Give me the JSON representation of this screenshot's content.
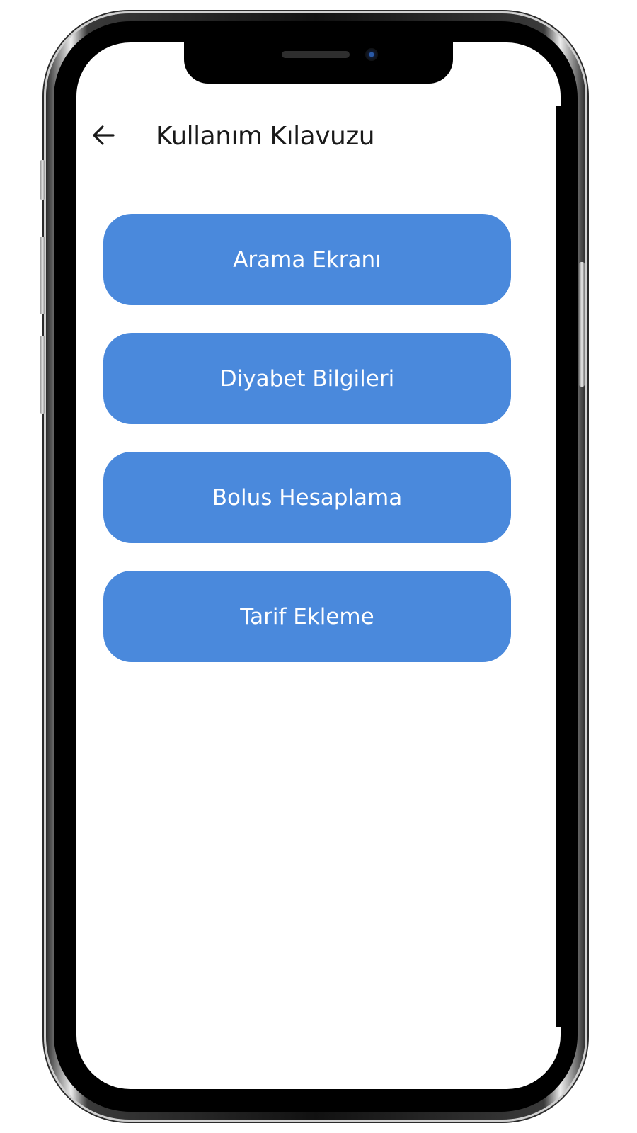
{
  "header": {
    "back_icon": "arrow-left-icon",
    "title": "Kullanım Kılavuzu"
  },
  "menu": {
    "items": [
      {
        "label": "Arama Ekranı"
      },
      {
        "label": "Diyabet Bilgileri"
      },
      {
        "label": "Bolus Hesaplama"
      },
      {
        "label": "Tarif Ekleme"
      }
    ]
  },
  "colors": {
    "button_background": "#4a89dc",
    "button_text": "#ffffff",
    "title_text": "#1a1a1a",
    "screen_background": "#ffffff"
  }
}
